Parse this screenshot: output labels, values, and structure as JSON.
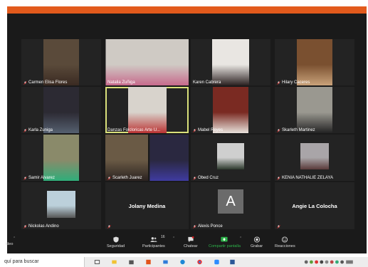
{
  "participants": [
    {
      "name": "Carmen Elisa Flores",
      "muted": true,
      "kind": "video",
      "bg": "#5a4a3a",
      "fg": "#3a2a22"
    },
    {
      "name": "Natalia Zuñiga",
      "muted": false,
      "kind": "video",
      "bg": "#cfcac4",
      "fg": "#c76a8c"
    },
    {
      "name": "Karen Cabrera",
      "muted": false,
      "kind": "video",
      "bg": "#e9e6e2",
      "fg": "#2a2020"
    },
    {
      "name": "Hilary Caceres",
      "muted": true,
      "kind": "video",
      "bg": "#7a5030",
      "fg": "#c9a27a"
    },
    {
      "name": "Karla Zuniga",
      "muted": true,
      "kind": "video",
      "bg": "#2c2a33",
      "fg": "#556070"
    },
    {
      "name": "Danzas Folcloricas Arte U...",
      "muted": false,
      "kind": "video",
      "bg": "#d8d3cc",
      "fg": "#b33",
      "active": true
    },
    {
      "name": "Mabel Reyes",
      "muted": true,
      "kind": "video",
      "bg": "#7a2a22",
      "fg": "#e8e2dc"
    },
    {
      "name": "Skarleth Martinez",
      "muted": true,
      "kind": "video",
      "bg": "#9a9890",
      "fg": "#222"
    },
    {
      "name": "Samir Alvarez",
      "muted": true,
      "kind": "video",
      "bg": "#8a8a6a",
      "fg": "#2fae7a"
    },
    {
      "name": "Scarleth Juarez",
      "muted": true,
      "kind": "video",
      "bg": "#6a5a45",
      "fg": "#2a2220"
    },
    {
      "name": "",
      "muted": false,
      "kind": "video",
      "bg": "#2a2840",
      "fg": "#3f3ba0"
    },
    {
      "name": "KENIA NATHALIE ZELAYA",
      "muted": true,
      "kind": "video",
      "bg": "#a9a5a8",
      "fg": "#5a3a3a"
    },
    {
      "name": "Obed Cruz",
      "muted": true,
      "kind": "video",
      "bg": "#cfcfcf",
      "fg": "#2d3a2d"
    },
    {
      "name": "Nickolas Andino",
      "muted": true,
      "kind": "video",
      "bg": "#bcd0db",
      "fg": "#555"
    },
    {
      "name": "",
      "muted": true,
      "kind": "text",
      "display": "Jolany Medina"
    },
    {
      "name": "Alexis Ponce",
      "muted": true,
      "kind": "avatar",
      "initial": "A"
    },
    {
      "name": "",
      "muted": true,
      "kind": "text",
      "display": "Angie La Colocha"
    }
  ],
  "toolbar": {
    "video_label": "ideo",
    "security": "Seguridad",
    "participants": "Participantes",
    "participants_count": "16",
    "chat": "Chatear",
    "share": "Compartir pantalla",
    "record": "Grabar",
    "reactions": "Reacciones"
  },
  "taskbar": {
    "search_placeholder": "quí para buscar"
  },
  "colors": {
    "accent": "#e25a1c",
    "active_border": "#d9e07a",
    "share_green": "#2db34a",
    "muted_red": "#e02020"
  }
}
